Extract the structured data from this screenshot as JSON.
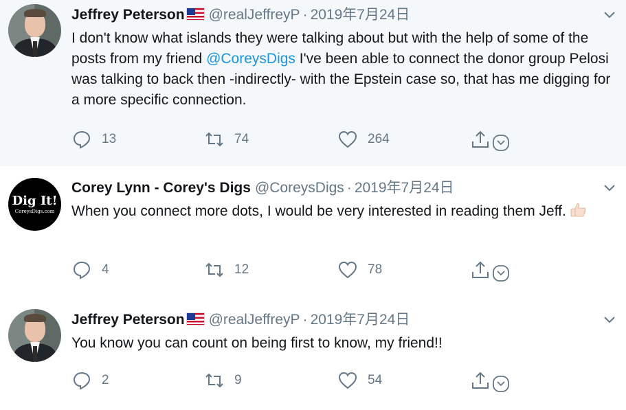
{
  "tweets": [
    {
      "name": "Jeffrey Peterson",
      "handle": "@realJeffreyP",
      "separator": "·",
      "date": "2019年7月24日",
      "avatar_type": "photo",
      "text_parts": [
        "I don't know what islands they were talking about but with the help of some of the posts from my friend ",
        "@CoreysDigs",
        " I've been able to connect the donor group Pelosi was talking to back then -indirectly- with the Epstein case so, that has me digging for a more specific connection."
      ],
      "replies": "13",
      "retweets": "74",
      "likes": "264"
    },
    {
      "name": "Corey Lynn - Corey's Digs",
      "handle": "@CoreysDigs",
      "separator": "·",
      "date": "2019年7月24日",
      "avatar_type": "logo",
      "logo_title": "Dig It!",
      "logo_sub": "CoreysDigs.com",
      "text": "When you connect more dots, I would be very interested in reading them Jeff.",
      "replies": "4",
      "retweets": "12",
      "likes": "78"
    },
    {
      "name": "Jeffrey Peterson",
      "handle": "@realJeffreyP",
      "separator": "·",
      "date": "2019年7月24日",
      "avatar_type": "photo",
      "text": "You know you can count on being first to know, my friend!!",
      "replies": "2",
      "retweets": "9",
      "likes": "54"
    }
  ],
  "icons": {
    "reply": "reply-icon",
    "retweet": "retweet-icon",
    "like": "heart-icon",
    "share": "share-icon",
    "more": "chevron-down-icon",
    "flag": "us-flag-icon",
    "thumbs_up": "thumbs-up-emoji"
  },
  "colors": {
    "link": "#1b95e0",
    "muted": "#657786",
    "highlight_bg": "#f5f8fa",
    "thread_line": "#ccd6dd"
  }
}
